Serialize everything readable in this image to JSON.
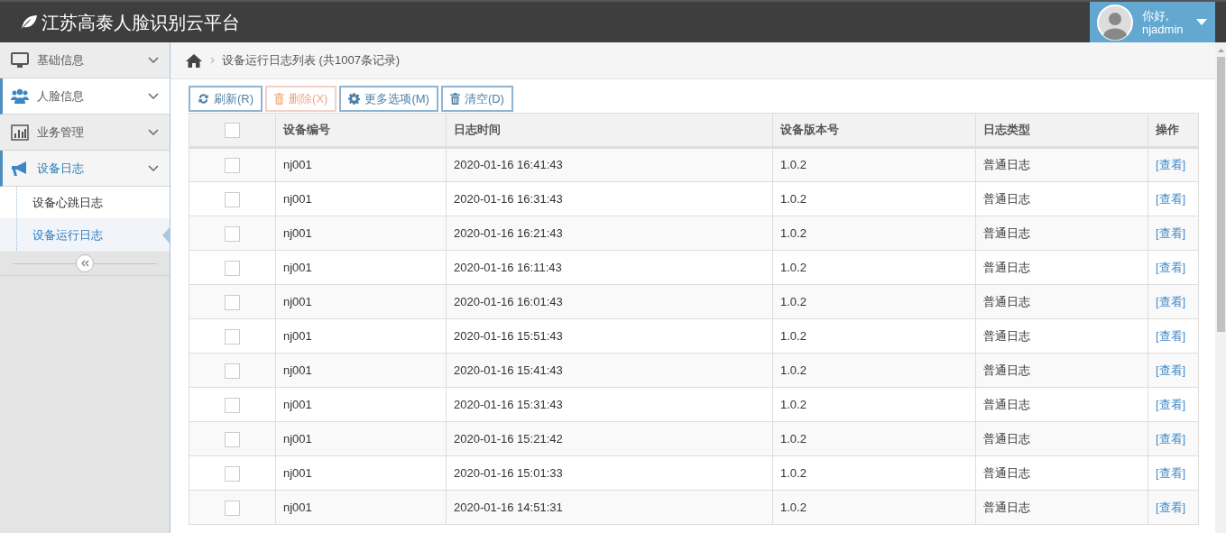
{
  "header": {
    "title": "江苏高泰人脸识别云平台",
    "user": {
      "greeting": "你好,",
      "name": "njadmin"
    }
  },
  "sidebar": {
    "items": [
      {
        "label": "基础信息",
        "kind": "monitor",
        "highlighted": false,
        "expanded": false
      },
      {
        "label": "人脸信息",
        "kind": "users",
        "highlighted": true,
        "expanded": false
      },
      {
        "label": "业务管理",
        "kind": "chart",
        "highlighted": false,
        "expanded": false
      },
      {
        "label": "设备日志",
        "kind": "bullhorn",
        "highlighted": false,
        "expanded": true,
        "children": [
          {
            "label": "设备心跳日志",
            "selected": false
          },
          {
            "label": "设备运行日志",
            "selected": true
          }
        ]
      }
    ]
  },
  "breadcrumb": "设备运行日志列表 (共1007条记录)",
  "toolbar": [
    {
      "label": "刷新(R)",
      "kind": "refresh",
      "disabled": false
    },
    {
      "label": "删除(X)",
      "kind": "delete",
      "disabled": true
    },
    {
      "label": "更多选项(M)",
      "kind": "options",
      "disabled": false
    },
    {
      "label": "清空(D)",
      "kind": "clear",
      "disabled": false
    }
  ],
  "table": {
    "header_checked": false,
    "columns": [
      "设备编号",
      "日志时间",
      "设备版本号",
      "日志类型",
      "操作"
    ],
    "rows": [
      {
        "checked": false,
        "cells": [
          "nj001",
          "2020-01-16 16:41:43",
          "1.0.2",
          "普通日志",
          "[查看]"
        ]
      },
      {
        "checked": false,
        "cells": [
          "nj001",
          "2020-01-16 16:31:43",
          "1.0.2",
          "普通日志",
          "[查看]"
        ]
      },
      {
        "checked": false,
        "cells": [
          "nj001",
          "2020-01-16 16:21:43",
          "1.0.2",
          "普通日志",
          "[查看]"
        ]
      },
      {
        "checked": false,
        "cells": [
          "nj001",
          "2020-01-16 16:11:43",
          "1.0.2",
          "普通日志",
          "[查看]"
        ]
      },
      {
        "checked": false,
        "cells": [
          "nj001",
          "2020-01-16 16:01:43",
          "1.0.2",
          "普通日志",
          "[查看]"
        ]
      },
      {
        "checked": false,
        "cells": [
          "nj001",
          "2020-01-16 15:51:43",
          "1.0.2",
          "普通日志",
          "[查看]"
        ]
      },
      {
        "checked": false,
        "cells": [
          "nj001",
          "2020-01-16 15:41:43",
          "1.0.2",
          "普通日志",
          "[查看]"
        ]
      },
      {
        "checked": false,
        "cells": [
          "nj001",
          "2020-01-16 15:31:43",
          "1.0.2",
          "普通日志",
          "[查看]"
        ]
      },
      {
        "checked": false,
        "cells": [
          "nj001",
          "2020-01-16 15:21:42",
          "1.0.2",
          "普通日志",
          "[查看]"
        ]
      },
      {
        "checked": false,
        "cells": [
          "nj001",
          "2020-01-16 15:01:33",
          "1.0.2",
          "普通日志",
          "[查看]"
        ]
      },
      {
        "checked": false,
        "cells": [
          "nj001",
          "2020-01-16 14:51:31",
          "1.0.2",
          "普通日志",
          "[查看]"
        ]
      }
    ]
  }
}
